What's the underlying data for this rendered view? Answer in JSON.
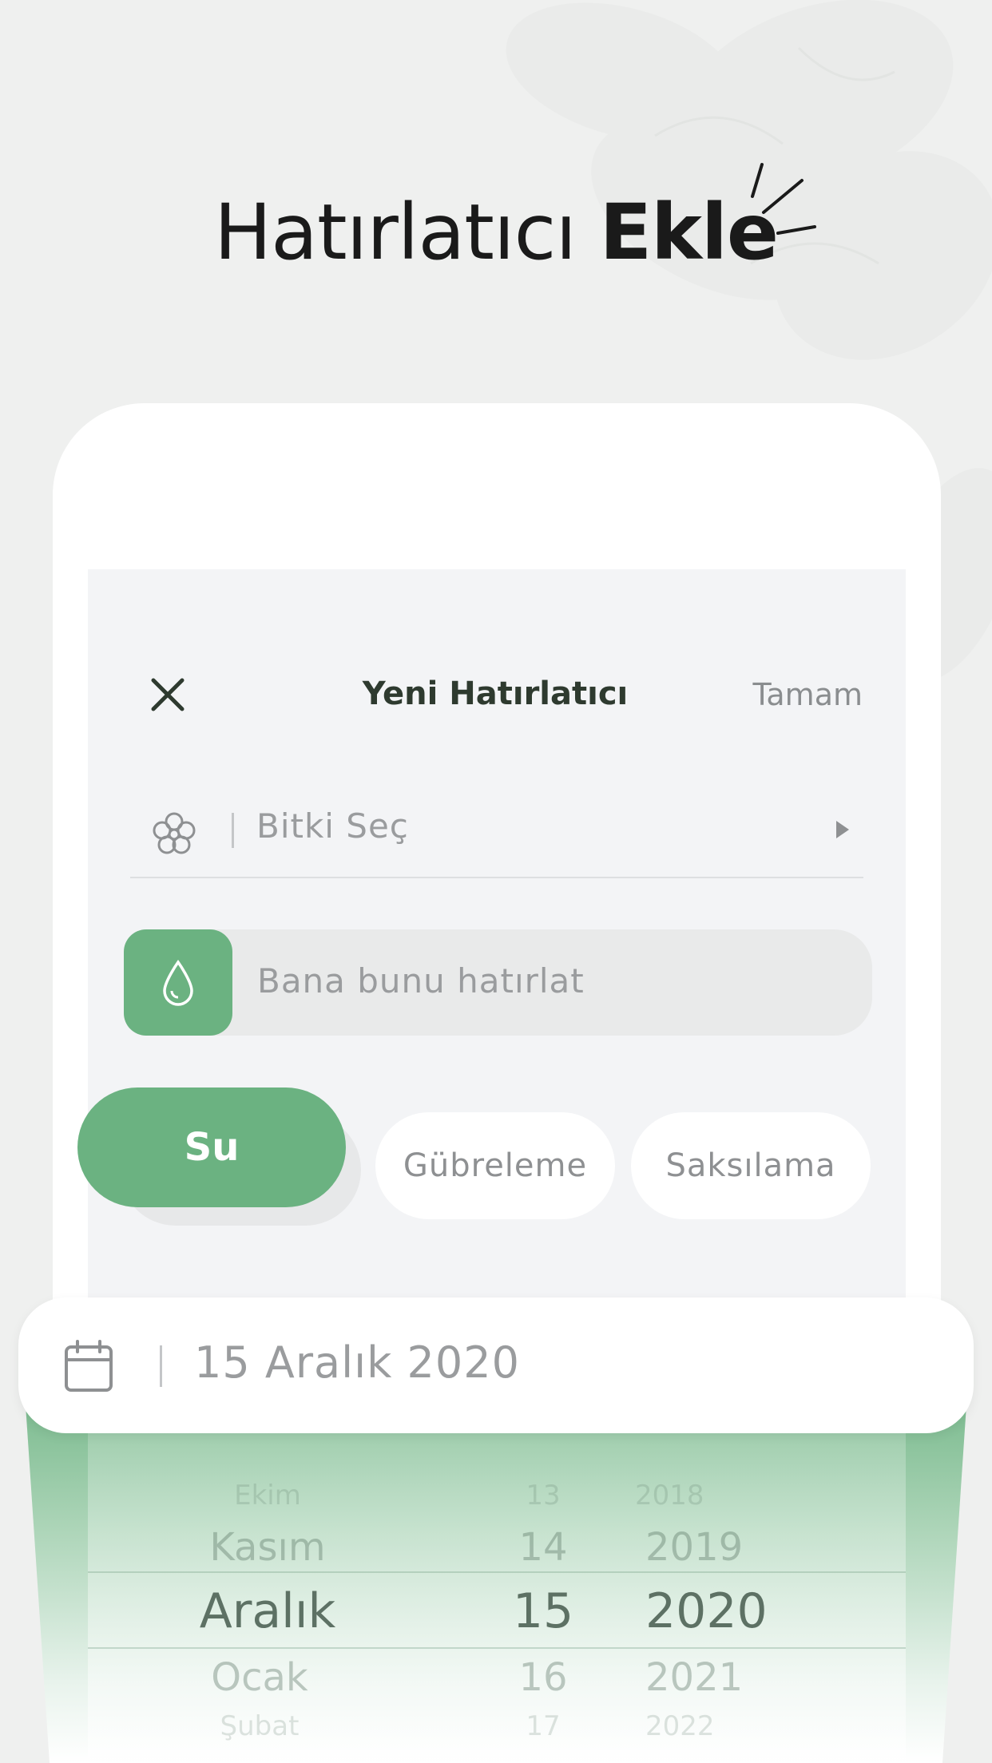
{
  "headline": {
    "light": "Hatırlatıcı",
    "bold": "Ekle"
  },
  "nav": {
    "title": "Yeni Hatırlatıcı",
    "done": "Tamam"
  },
  "plant_select": {
    "label": "Bitki Seç",
    "icon": "flower-icon"
  },
  "remind": {
    "placeholder": "Bana bunu hatırlat",
    "icon": "water-drop-icon"
  },
  "chips": [
    {
      "label": "Su",
      "selected": true
    },
    {
      "label": "Gübreleme",
      "selected": false
    },
    {
      "label": "Saksılama",
      "selected": false
    }
  ],
  "date": {
    "value": "15 Aralık 2020",
    "icon": "calendar-icon"
  },
  "picker": {
    "months": [
      "Ekim",
      "Kasım",
      "Aralık",
      "Ocak",
      "Şubat"
    ],
    "days": [
      "13",
      "14",
      "15",
      "16",
      "17"
    ],
    "years": [
      "2018",
      "2019",
      "2020",
      "2021",
      "2022"
    ],
    "selected_index": 2
  },
  "colors": {
    "accent": "#6bb281",
    "background": "#eff0ef",
    "screen": "#f3f4f6"
  }
}
